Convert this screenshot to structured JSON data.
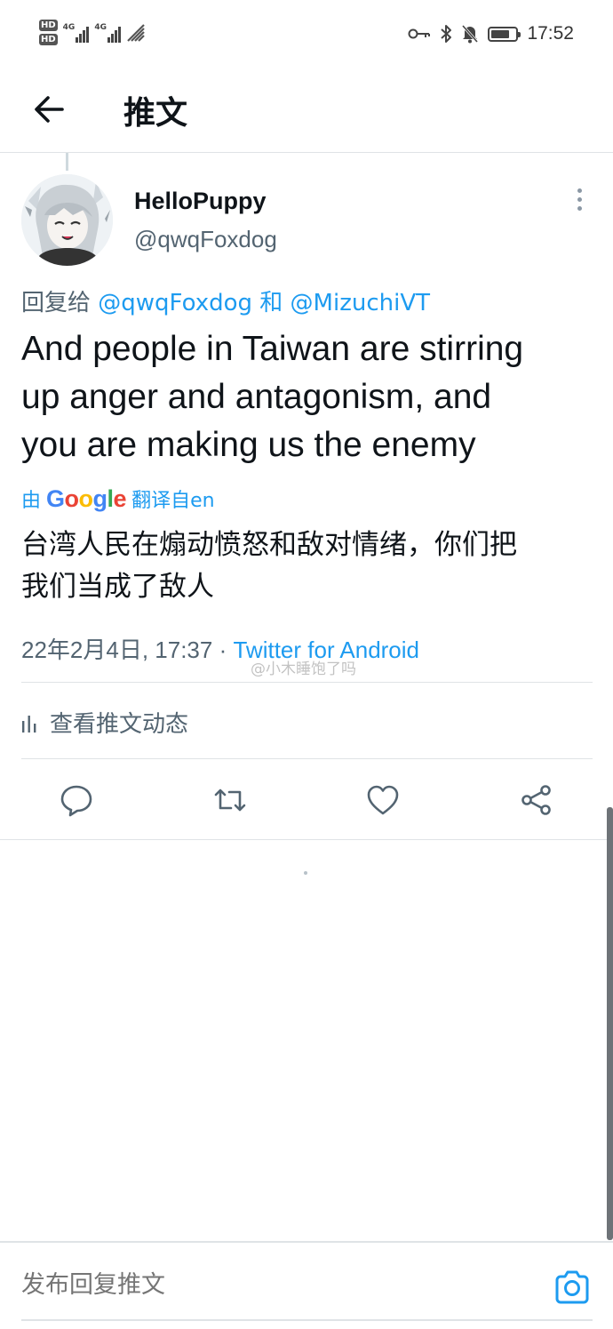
{
  "status_bar": {
    "hd1": "HD",
    "hd2": "HD",
    "net1": "4G",
    "net2": "4G",
    "time": "17:52",
    "battery_level": 0.75,
    "icons": [
      "key-icon",
      "bluetooth-icon",
      "bell-muted-icon",
      "battery-icon"
    ]
  },
  "header": {
    "title": "推文",
    "back_icon": "arrow-left-icon"
  },
  "tweet": {
    "display_name": "HelloPuppy",
    "handle": "@qwqFoxdog",
    "reply_prefix": "回复给",
    "reply_mention_1": "@qwqFoxdog",
    "reply_conjunction": "和",
    "reply_mention_2": "@MizuchiVT",
    "text_line_1": "And people in Taiwan are stirring",
    "text_line_2": "up anger and antagonism, and",
    "text_line_3": "you are making us the enemy",
    "translated_prefix": "由",
    "translated_suffix": "翻译自en",
    "translation_line_1": "台湾人民在煽动愤怒和敌对情绪，你们把",
    "translation_line_2": "我们当成了敌人",
    "timestamp": "22年2月4日, 17:37 · ",
    "source": "Twitter for Android",
    "watermark": "@小木睡饱了吗"
  },
  "activity": {
    "label": "查看推文动态",
    "icon": "bar-chart-icon"
  },
  "actions": {
    "icons": [
      "reply-icon",
      "retweet-icon",
      "like-icon",
      "share-icon"
    ]
  },
  "composer": {
    "placeholder": "发布回复推文",
    "camera_icon": "camera-icon"
  },
  "colors": {
    "accent": "#1d9bf0",
    "text": "#0f1419",
    "secondary": "#536471",
    "divider": "#dfe3e6"
  }
}
